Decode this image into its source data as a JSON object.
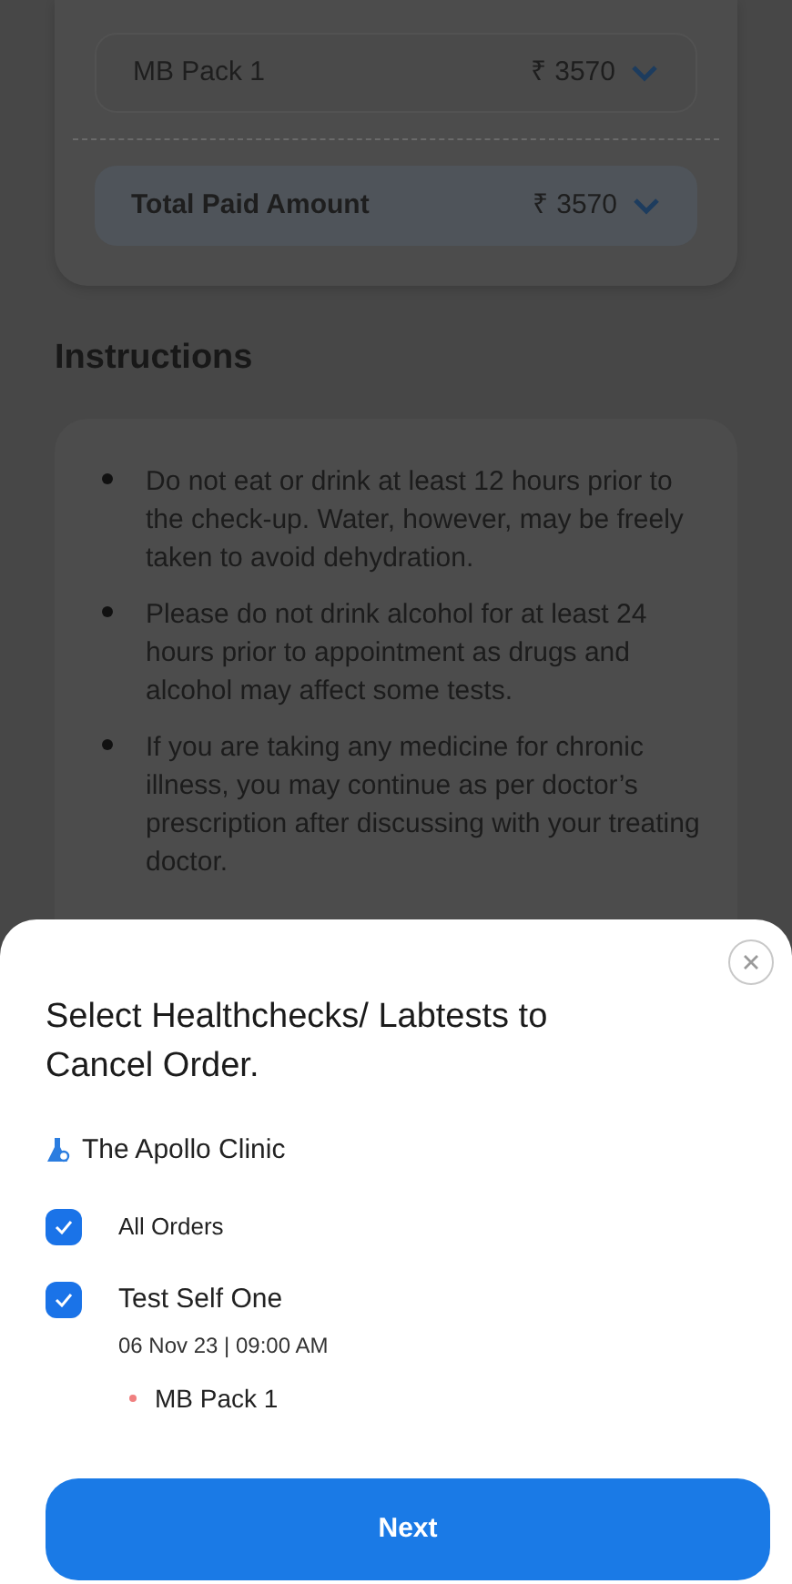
{
  "summary": {
    "items": [
      {
        "name": "MB Pack 1",
        "amount": "₹ 3570",
        "kind": "item"
      },
      {
        "name": "Total Paid Amount",
        "amount": "₹ 3570",
        "kind": "total"
      }
    ]
  },
  "instructions": {
    "title": "Instructions",
    "items": [
      "Do not eat or drink at least 12 hours prior to the check-up. Water, however, may be freely taken to avoid dehydration.",
      "Please do not drink alcohol for at least 24 hours prior to appointment as drugs and alcohol may affect some tests.",
      "If you are taking any medicine for chronic illness, you may continue as per doctor’s prescription after discussing with your treating doctor."
    ]
  },
  "sheet": {
    "title": "Select Healthchecks/ Labtests to Cancel Order.",
    "clinic": "The Apollo Clinic",
    "all_orders": {
      "label": "All Orders",
      "checked": true
    },
    "orders": [
      {
        "name": "Test Self One",
        "checked": true,
        "datetime": "06 Nov 23 | 09:00 AM",
        "tests": [
          "MB Pack 1"
        ]
      }
    ],
    "button": "Next"
  }
}
